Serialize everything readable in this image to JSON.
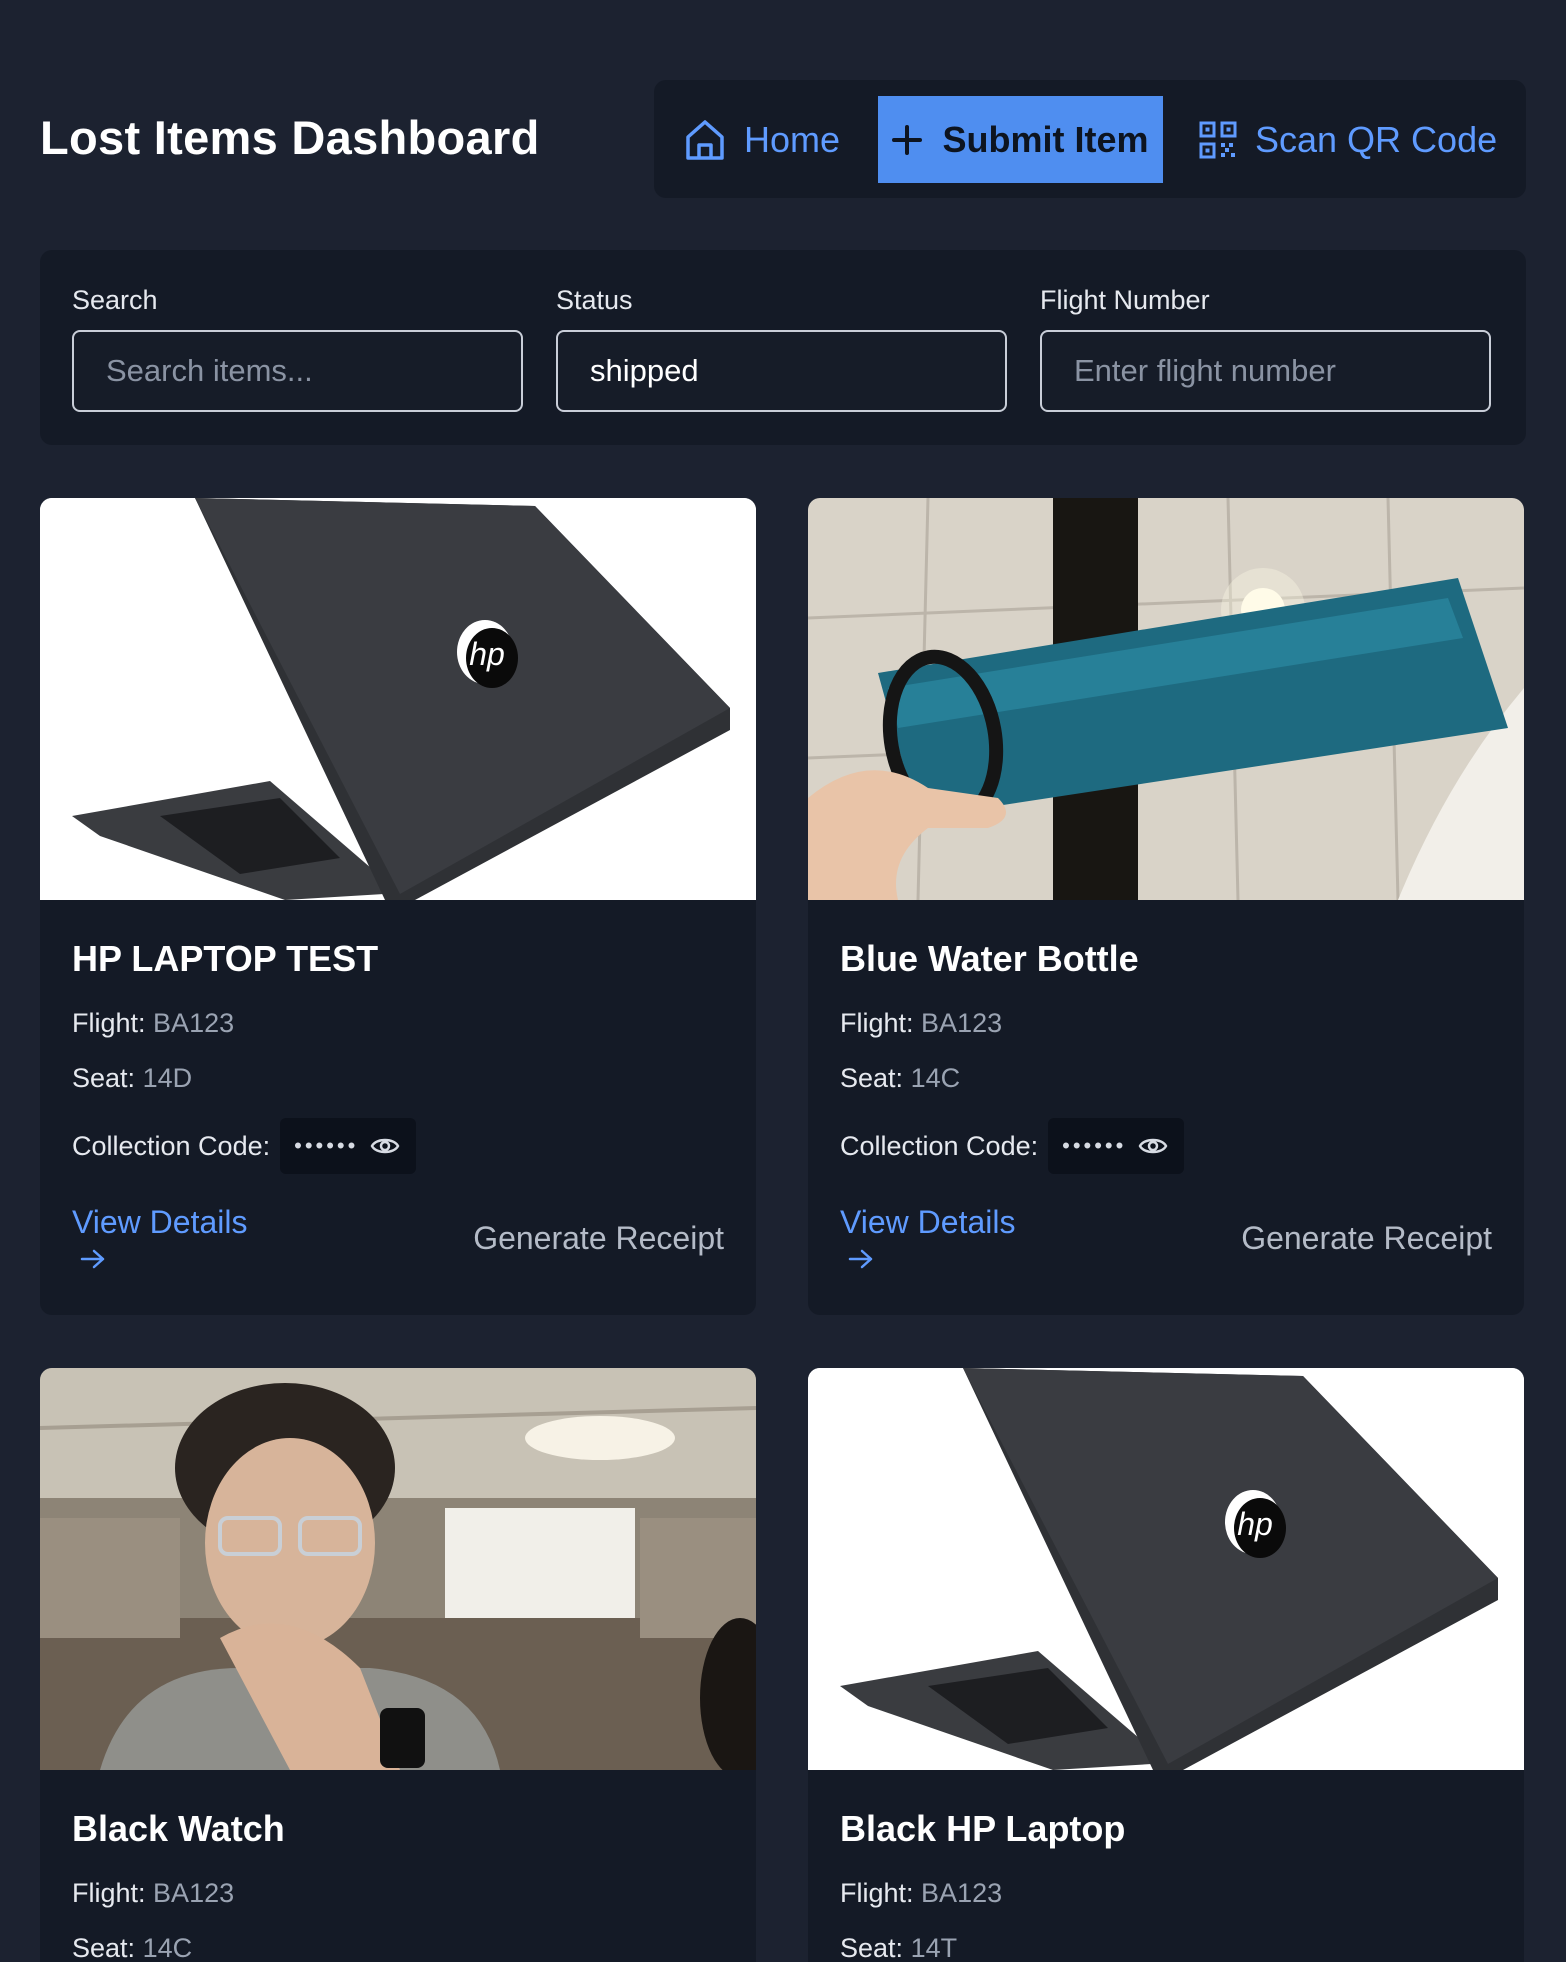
{
  "header": {
    "title": "Lost Items Dashboard",
    "nav": {
      "home_label": "Home",
      "submit_label": "Submit Item",
      "scan_label": "Scan QR Code"
    }
  },
  "filters": {
    "search": {
      "label": "Search",
      "placeholder": "Search items...",
      "value": ""
    },
    "status": {
      "label": "Status",
      "value": "shipped"
    },
    "flight": {
      "label": "Flight Number",
      "placeholder": "Enter flight number",
      "value": ""
    }
  },
  "labels": {
    "flight": "Flight:",
    "seat": "Seat:",
    "collection_code": "Collection Code:",
    "masked_code": "••••••",
    "view_details": "View Details",
    "generate_receipt": "Generate Receipt"
  },
  "items": [
    {
      "title": "HP LAPTOP TEST",
      "flight": "BA123",
      "seat": "14D",
      "image": "laptop-photo"
    },
    {
      "title": "Blue Water Bottle",
      "flight": "BA123",
      "seat": "14C",
      "image": "water-bottle-photo"
    },
    {
      "title": "Black Watch",
      "flight": "BA123",
      "seat": "14C",
      "image": "person-wearing-watch-photo"
    },
    {
      "title": "Black HP Laptop",
      "flight": "BA123",
      "seat": "14T",
      "image": "laptop-photo"
    }
  ],
  "colors": {
    "background": "#1c2230",
    "panel": "#141a26",
    "accent": "#5f9bff",
    "accent_button": "#4f8ef0"
  }
}
